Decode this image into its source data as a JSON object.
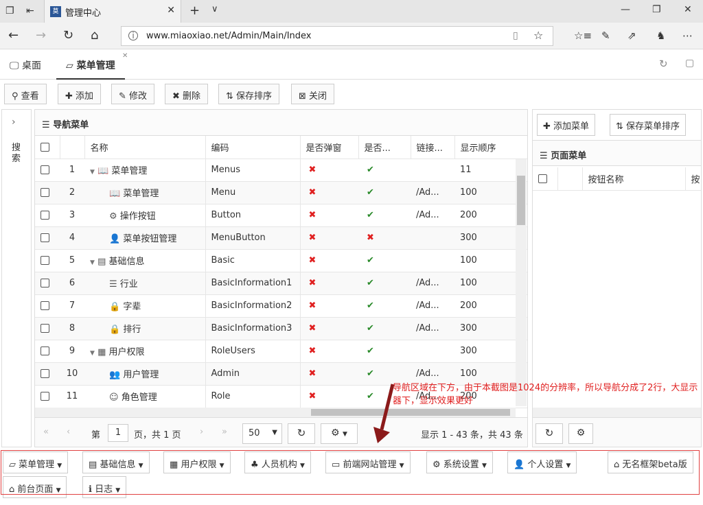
{
  "browser": {
    "tab_title": "管理中心",
    "url": "www.miaoxiao.net/Admin/Main/Index"
  },
  "app_tabs": [
    {
      "label": "桌面"
    },
    {
      "label": "菜单管理"
    }
  ],
  "toolbar": {
    "view": "查看",
    "add": "添加",
    "edit": "修改",
    "delete": "删除",
    "save_order": "保存排序",
    "close": "关闭"
  },
  "side": {
    "search_label": "搜索"
  },
  "nav_panel": {
    "title": "导航菜单",
    "columns": [
      "名称",
      "编码",
      "是否弹窗",
      "是否...",
      "链接...",
      "显示顺序"
    ],
    "rows": [
      {
        "num": "1",
        "name": "菜单管理",
        "code": "Menus",
        "popup": "x",
        "enabled": "ok",
        "link": "",
        "order": "11"
      },
      {
        "num": "2",
        "name": "菜单管理",
        "code": "Menu",
        "popup": "x",
        "enabled": "ok",
        "link": "/Ad...",
        "order": "100"
      },
      {
        "num": "3",
        "name": "操作按钮",
        "code": "Button",
        "popup": "x",
        "enabled": "ok",
        "link": "/Ad...",
        "order": "200"
      },
      {
        "num": "4",
        "name": "菜单按钮管理",
        "code": "MenuButton",
        "popup": "x",
        "enabled": "x",
        "link": "",
        "order": "300"
      },
      {
        "num": "5",
        "name": "基础信息",
        "code": "Basic",
        "popup": "x",
        "enabled": "ok",
        "link": "",
        "order": "100"
      },
      {
        "num": "6",
        "name": "行业",
        "code": "BasicInformation1",
        "popup": "x",
        "enabled": "ok",
        "link": "/Ad...",
        "order": "100"
      },
      {
        "num": "7",
        "name": "字辈",
        "code": "BasicInformation2",
        "popup": "x",
        "enabled": "ok",
        "link": "/Ad...",
        "order": "200"
      },
      {
        "num": "8",
        "name": "排行",
        "code": "BasicInformation3",
        "popup": "x",
        "enabled": "ok",
        "link": "/Ad...",
        "order": "300"
      },
      {
        "num": "9",
        "name": "用户权限",
        "code": "RoleUsers",
        "popup": "x",
        "enabled": "ok",
        "link": "",
        "order": "300"
      },
      {
        "num": "10",
        "name": "用户管理",
        "code": "Admin",
        "popup": "x",
        "enabled": "ok",
        "link": "/Ad...",
        "order": "100"
      },
      {
        "num": "11",
        "name": "角色管理",
        "code": "Role",
        "popup": "x",
        "enabled": "ok",
        "link": "/Ad...",
        "order": "200"
      }
    ],
    "pager": {
      "page_prefix": "第",
      "page": "1",
      "page_suffix": "页，共 1 页",
      "page_size": "50",
      "summary": "显示 1 - 43 条，共 43 条"
    }
  },
  "page_panel": {
    "add_label": "添加菜单",
    "save_label": "保存菜单排序",
    "title": "页面菜单",
    "columns": [
      "按钮名称",
      "按"
    ]
  },
  "bottom_nav": [
    {
      "label": "菜单管理"
    },
    {
      "label": "基础信息"
    },
    {
      "label": "用户权限"
    },
    {
      "label": "人员机构"
    },
    {
      "label": "前端网站管理"
    },
    {
      "label": "系统设置"
    },
    {
      "label": "个人设置"
    },
    {
      "label": "无名框架beta版"
    },
    {
      "label": "前台页面"
    },
    {
      "label": "日志"
    }
  ],
  "annotation": {
    "text": "导航区域在下方，由于本截图是1024的分辨率，所以导航分成了2行，大显示器下，显示效果更好"
  }
}
